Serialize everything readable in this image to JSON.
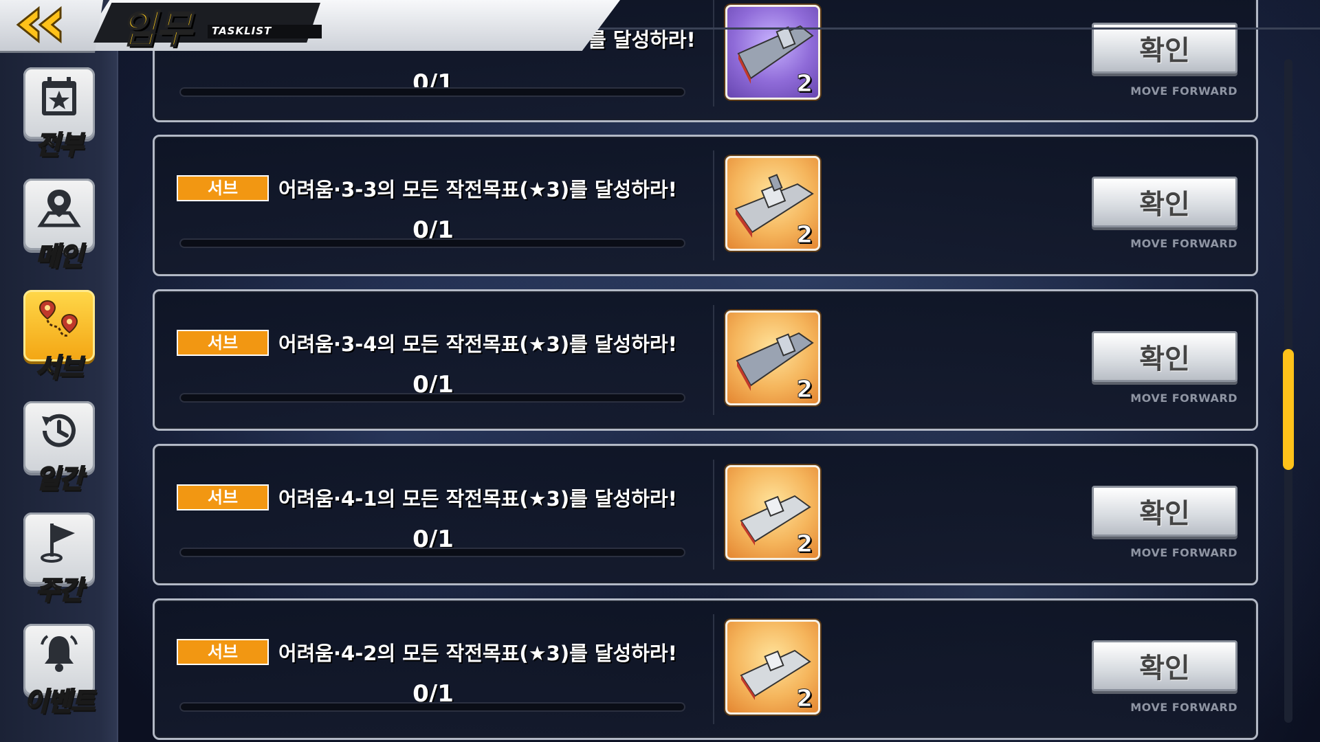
{
  "header": {
    "title": "임무",
    "subtitle": "TASKLIST"
  },
  "sidebar": {
    "items": [
      {
        "label": "전부",
        "icon": "star-calendar-icon",
        "active": false
      },
      {
        "label": "메인",
        "icon": "map-pin-icon",
        "active": false
      },
      {
        "label": "서브",
        "icon": "route-pins-icon",
        "active": true
      },
      {
        "label": "일간",
        "icon": "history-clock-icon",
        "active": false
      },
      {
        "label": "주간",
        "icon": "flag-icon",
        "active": false
      },
      {
        "label": "이벤트",
        "icon": "bell-icon",
        "active": false
      }
    ]
  },
  "partial_task": {
    "desc": "를 달성하라!",
    "progress_text": "0/1",
    "progress": 0,
    "reward_count": "2",
    "reward_icon": "carrier-ship-icon",
    "button": "확인",
    "move": "MOVE FORWARD"
  },
  "tasks": [
    {
      "tag": "서브",
      "desc": "어려움·3-3의 모든 작전목표(★3)를 달성하라!",
      "progress_text": "0/1",
      "progress": 0,
      "reward_count": "2",
      "reward_icon": "battleship-icon",
      "button": "확인",
      "move": "MOVE FORWARD"
    },
    {
      "tag": "서브",
      "desc": "어려움·3-4의 모든 작전목표(★3)를 달성하라!",
      "progress_text": "0/1",
      "progress": 0,
      "reward_count": "2",
      "reward_icon": "carrier-ship-icon",
      "button": "확인",
      "move": "MOVE FORWARD"
    },
    {
      "tag": "서브",
      "desc": "어려움·4-1의 모든 작전목표(★3)를 달성하라!",
      "progress_text": "0/1",
      "progress": 0,
      "reward_count": "2",
      "reward_icon": "destroyer-ship-icon",
      "button": "확인",
      "move": "MOVE FORWARD"
    },
    {
      "tag": "서브",
      "desc": "어려움·4-2의 모든 작전목표(★3)를 달성하라!",
      "progress_text": "0/1",
      "progress": 0,
      "reward_count": "2",
      "reward_icon": "destroyer-ship-icon",
      "button": "확인",
      "move": "MOVE FORWARD"
    }
  ],
  "colors": {
    "tag": "#f29712",
    "active_tab": "#ffcc00",
    "scroll_thumb": "#ffc21a"
  }
}
